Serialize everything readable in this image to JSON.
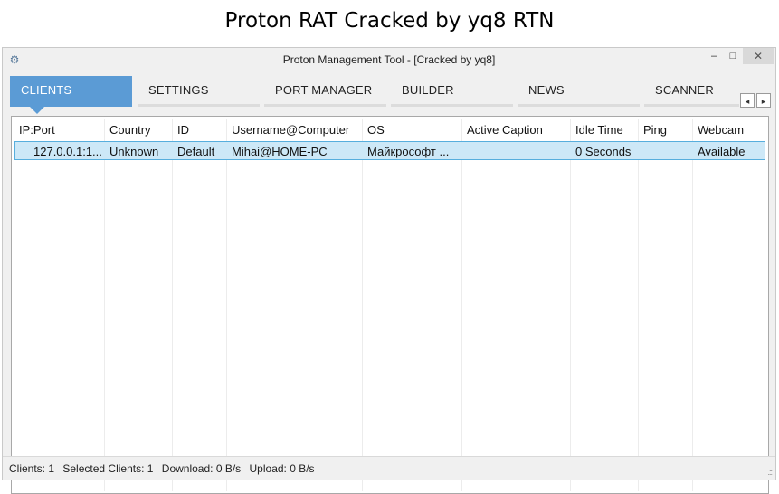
{
  "banner": {
    "title": "Proton RAT Cracked by yq8 RTN"
  },
  "window": {
    "title": "Proton Management Tool - [Cracked by yq8]",
    "minimize": "–",
    "maximize": "□",
    "close": "✕",
    "app_icon": "gear-icon"
  },
  "tabs": [
    {
      "label": "CLIENTS",
      "active": true
    },
    {
      "label": "SETTINGS",
      "active": false
    },
    {
      "label": "PORT MANAGER",
      "active": false
    },
    {
      "label": "BUILDER",
      "active": false
    },
    {
      "label": "NEWS",
      "active": false
    },
    {
      "label": "SCANNER",
      "active": false
    }
  ],
  "tab_scroll": {
    "left": "◂",
    "right": "▸"
  },
  "table": {
    "columns": [
      "IP:Port",
      "Country",
      "ID",
      "Username@Computer",
      "OS",
      "Active Caption",
      "Idle Time",
      "Ping",
      "Webcam"
    ],
    "rows": [
      [
        "127.0.0.1:1...",
        "Unknown",
        "Default",
        "Mihai@HOME-PC",
        "Майкрософт ...",
        "",
        "0 Seconds",
        "",
        "Available"
      ]
    ]
  },
  "status": {
    "clients": "Clients: 1",
    "selected": "Selected Clients: 1",
    "download": "Download: 0 B/s",
    "upload": "Upload: 0 B/s",
    "grip": ".::"
  },
  "colors": {
    "accent": "#5b9bd5",
    "selection": "#cde8f7",
    "selection_border": "#57aedd"
  }
}
